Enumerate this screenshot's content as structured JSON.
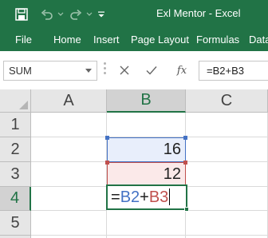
{
  "window": {
    "title": "Exl Mentor  -  Excel"
  },
  "quick_access": {
    "icons": [
      "save-icon",
      "undo-icon",
      "redo-icon",
      "customize-toolbar-icon"
    ]
  },
  "ribbon": {
    "tabs": [
      {
        "label": "File"
      },
      {
        "label": "Home"
      },
      {
        "label": "Insert"
      },
      {
        "label": "Page Layout"
      },
      {
        "label": "Formulas"
      },
      {
        "label": "Data"
      }
    ]
  },
  "formula_bar": {
    "name_box": "SUM",
    "value": "=B2+B3",
    "fx_label": "fx"
  },
  "sheet": {
    "columns": [
      "A",
      "B",
      "C"
    ],
    "rows": [
      "1",
      "2",
      "3",
      "4",
      "5"
    ],
    "selected_column": "B",
    "selected_row": "4",
    "cells": {
      "B2": "16",
      "B3": "12"
    },
    "edit_tokens": {
      "eq": "=",
      "ref1": "B2",
      "op": "+",
      "ref2": "B3"
    }
  },
  "colors": {
    "excel_green": "#217346",
    "ref_blue": "#4472c4",
    "ref_red": "#c0504d"
  }
}
